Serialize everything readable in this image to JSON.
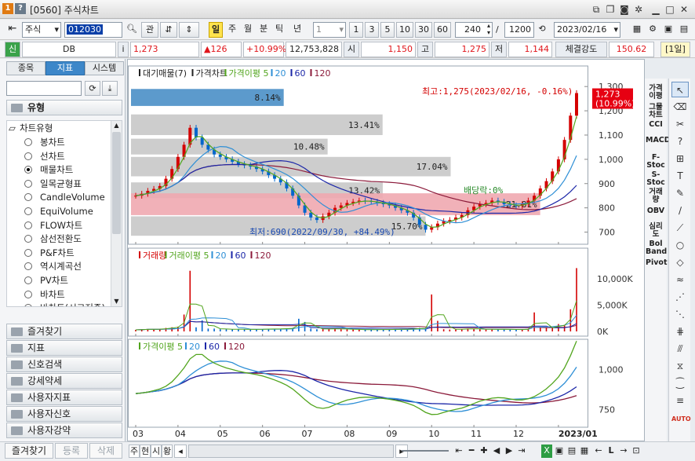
{
  "window": {
    "screen_id": "[0560]",
    "title": "주식차트"
  },
  "toolbar": {
    "market_type": "주식",
    "code": "012030",
    "btn_gwan": "관",
    "periods": [
      "일",
      "주",
      "월",
      "분",
      "틱",
      "년"
    ],
    "selected_period": "일",
    "interval_value": "1",
    "quick_intervals": [
      "1",
      "3",
      "5",
      "10",
      "30",
      "60"
    ],
    "count": "240",
    "total": "1200",
    "date": "2023/02/16"
  },
  "quote": {
    "credit_flag": "신",
    "stock_name": "DB",
    "info_button": "i",
    "price": "1,273",
    "change": "▲126",
    "change_pct": "+10.99%",
    "volume": "12,753,828",
    "open_label": "시",
    "open": "1,150",
    "high_label": "고",
    "high": "1,275",
    "low_label": "저",
    "low": "1,144",
    "strength_label": "체결강도",
    "strength": "150.62",
    "period_badge": "[1일]"
  },
  "left_panel": {
    "tabs": [
      "종목",
      "지표",
      "시스템"
    ],
    "selected_tab": "지표",
    "group_header": "유형",
    "tree_root": "차트유형",
    "items": [
      "봉차트",
      "선차트",
      "매물차트",
      "일목균형표",
      "CandleVolume",
      "EquiVolume",
      "FLOW차트",
      "삼선전환도",
      "P&F차트",
      "역시계곡선",
      "PV차트",
      "바차트",
      "바차트(시고저종)"
    ],
    "selected_item": "매물차트",
    "groups": [
      "즐겨찾기",
      "지표",
      "신호검색",
      "강세약세",
      "사용자지표",
      "사용자신호",
      "사용자강약"
    ]
  },
  "bottom": {
    "tabs": [
      "즐겨찾기",
      "등록",
      "삭제"
    ],
    "mini": [
      "주",
      "현",
      "시",
      "황"
    ]
  },
  "right_labels": [
    "가격이평",
    "그물차트",
    "CCI",
    "MACD",
    "F-Stoc",
    "S-Stoc",
    "거래량",
    "OBV",
    "심리도",
    "Bol Band",
    "Pivot"
  ],
  "chart_data": [
    {
      "type": "candlestick",
      "legend": [
        "대기매물(7)",
        "가격차트",
        "가격이평 5",
        "20",
        "60",
        "120"
      ],
      "colors": {
        "ma5": "#52a51e",
        "ma20": "#2e8fd6",
        "ma60": "#1c27a8",
        "ma120": "#8b1a3a",
        "up": "#d40000",
        "down": "#0066cc",
        "volume_profile": "#c8c8c8",
        "volume_profile_current": "#f0a8b0",
        "volume_profile_top": "#4a8fc7"
      },
      "y_ticks": [
        700,
        800,
        900,
        "1,000",
        "1,100",
        "1,200",
        "1,300"
      ],
      "ylim": [
        650,
        1320
      ],
      "current_price_label": "1,273",
      "current_pct_label": "(10.99%)",
      "high_annotation": "최고:1,275(2023/02/16, -0.16%)",
      "low_annotation": "최저:690(2022/09/30, +84.49%)",
      "dividend_annotation": "배당락:0%",
      "close": [
        850,
        858,
        870,
        878,
        890,
        920,
        960,
        1010,
        1060,
        1130,
        1090,
        1060,
        1040,
        1020,
        1010,
        1000,
        990,
        980,
        975,
        970,
        960,
        950,
        935,
        920,
        905,
        880,
        850,
        810,
        780,
        760,
        750,
        765,
        780,
        800,
        810,
        820,
        825,
        830,
        828,
        825,
        820,
        815,
        810,
        800,
        790,
        780,
        760,
        730,
        710,
        720,
        735,
        745,
        750,
        760,
        770,
        790,
        805,
        815,
        820,
        830,
        825,
        815,
        810,
        808,
        815,
        830,
        850,
        880,
        910,
        950,
        1000,
        1080,
        1180,
        1273
      ],
      "volume_profile": [
        {
          "label": "8.14%",
          "price_low": 1220,
          "price_high": 1290,
          "pct": 8.14
        },
        {
          "label": "13.41%",
          "price_low": 1100,
          "price_high": 1185,
          "pct": 13.41
        },
        {
          "label": "10.48%",
          "price_low": 1020,
          "price_high": 1085,
          "pct": 10.48
        },
        {
          "label": "17.04%",
          "price_low": 930,
          "price_high": 1010,
          "pct": 17.04
        },
        {
          "label": "13.42%",
          "price_low": 840,
          "price_high": 905,
          "pct": 13.42
        },
        {
          "label": "21.81%",
          "price_low": 770,
          "price_high": 860,
          "pct": 21.81
        },
        {
          "label": "15.70%",
          "price_low": 685,
          "price_high": 765,
          "pct": 15.7
        }
      ],
      "x_ticks": [
        "03",
        "04",
        "05",
        "06",
        "07",
        "08",
        "09",
        "10",
        "11",
        "12",
        "2023/01"
      ]
    },
    {
      "type": "bar",
      "legend": [
        "거래량",
        "거래이평 5",
        "20",
        "60",
        "120"
      ],
      "y_ticks": [
        "10,000K",
        "5,000K",
        "0K"
      ],
      "ylim": [
        0,
        12800
      ],
      "volume_spikes": [
        {
          "i": 9,
          "v": 11500
        },
        {
          "i": 8,
          "v": 3200
        },
        {
          "i": 11,
          "v": 2100
        },
        {
          "i": 27,
          "v": 2400
        },
        {
          "i": 28,
          "v": 1800
        },
        {
          "i": 49,
          "v": 7000
        },
        {
          "i": 50,
          "v": 2000
        },
        {
          "i": 66,
          "v": 3600
        },
        {
          "i": 70,
          "v": 1400
        },
        {
          "i": 72,
          "v": 4200
        },
        {
          "i": 73,
          "v": 12000
        }
      ]
    },
    {
      "type": "line",
      "legend": [
        "가격이평 5",
        "20",
        "60",
        "120"
      ],
      "y_ticks": [
        "1,000",
        750
      ],
      "ylim": [
        680,
        1110
      ]
    }
  ]
}
